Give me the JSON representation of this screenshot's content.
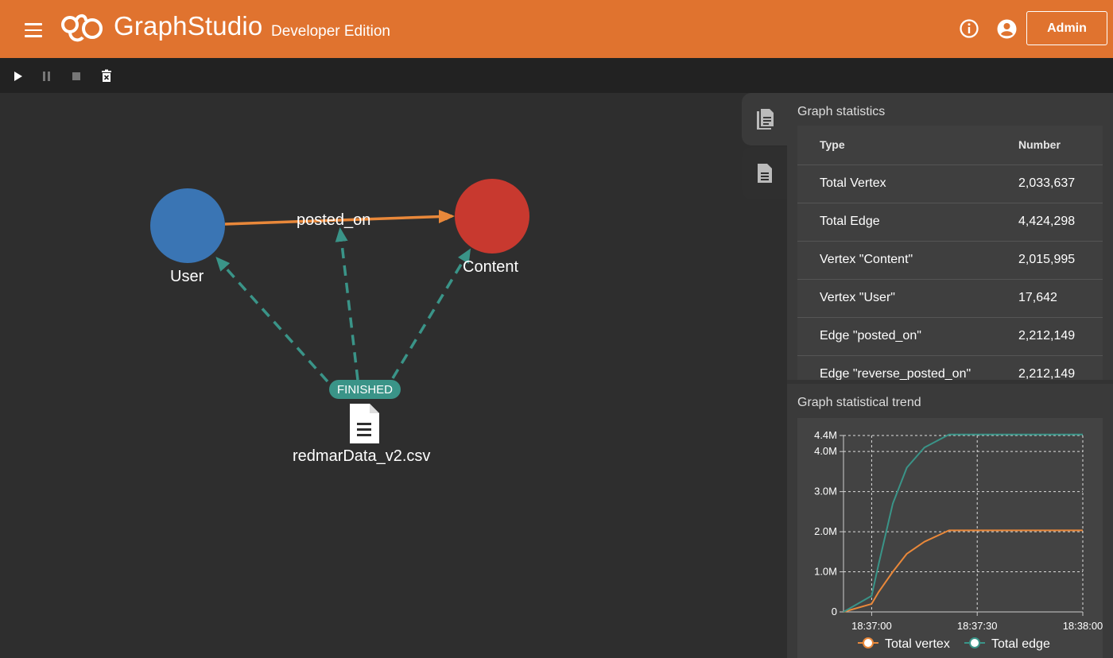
{
  "header": {
    "brand_graph": "Graph",
    "brand_studio": "Studio",
    "edition": "Developer Edition",
    "admin_label": "Admin",
    "accent_color": "#e0732f"
  },
  "toolbar": {
    "icons": [
      "play-icon",
      "pause-icon",
      "stop-icon",
      "clear-icon"
    ]
  },
  "graph": {
    "vertices": [
      {
        "name": "User",
        "color": "#3a75b4"
      },
      {
        "name": "Content",
        "color": "#c8392f"
      }
    ],
    "edge": {
      "name": "posted_on",
      "color": "#e9883a"
    },
    "job": {
      "status": "FINISHED",
      "file": "redmarData_v2.csv",
      "status_color": "#3a9488"
    }
  },
  "stats": {
    "title": "Graph statistics",
    "headers": [
      "Type",
      "Number"
    ],
    "rows": [
      {
        "type": "Total Vertex",
        "number": "2,033,637"
      },
      {
        "type": "Total Edge",
        "number": "4,424,298"
      },
      {
        "type": "Vertex \"Content\"",
        "number": "2,015,995"
      },
      {
        "type": "Vertex \"User\"",
        "number": "17,642"
      },
      {
        "type": "Edge \"posted_on\"",
        "number": "2,212,149"
      },
      {
        "type": "Edge \"reverse_posted_on\"",
        "number": "2,212,149"
      }
    ]
  },
  "trend": {
    "title": "Graph statistical trend",
    "chart_data": {
      "type": "line",
      "x": [
        "18:36:52",
        "18:37:00",
        "18:37:02",
        "18:37:06",
        "18:37:10",
        "18:37:15",
        "18:37:22",
        "18:37:30",
        "18:38:00"
      ],
      "x_ticks": [
        "18:37:00",
        "18:37:30",
        "18:38:00"
      ],
      "y_ticks": [
        "0",
        "1.0M",
        "2.0M",
        "3.0M",
        "4.0M",
        "4.4M"
      ],
      "ylim": [
        0,
        4400000
      ],
      "series": [
        {
          "name": "Total vertex",
          "color": "#e9883a",
          "values": [
            0,
            200000,
            500000,
            1000000,
            1450000,
            1750000,
            2033637,
            2033637,
            2033637
          ]
        },
        {
          "name": "Total edge",
          "color": "#3a9488",
          "values": [
            0,
            400000,
            1200000,
            2700000,
            3600000,
            4100000,
            4424298,
            4424298,
            4424298
          ]
        }
      ]
    }
  }
}
